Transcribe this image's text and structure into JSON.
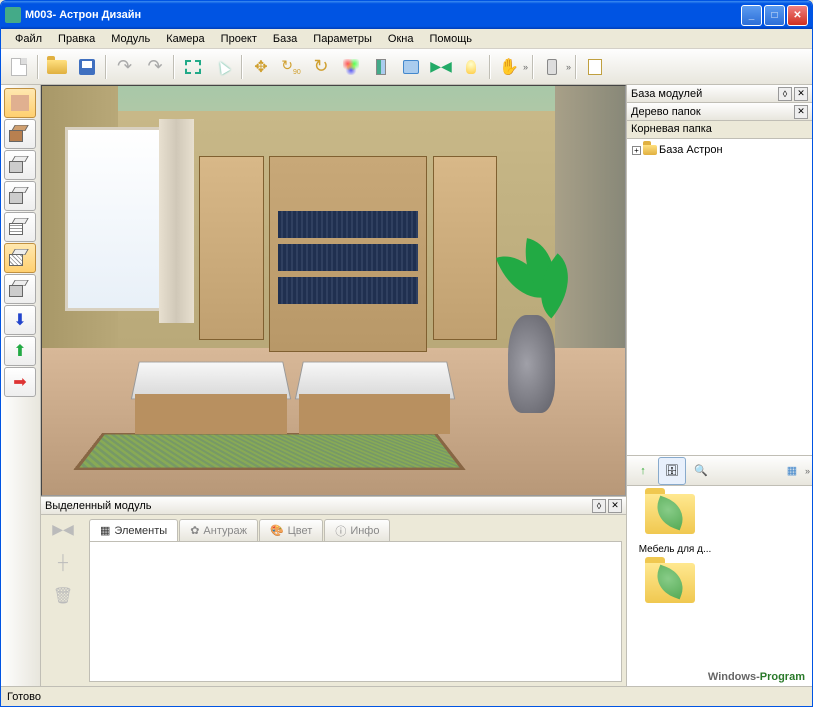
{
  "title": "М003- Астрон Дизайн",
  "menu": [
    "Файл",
    "Правка",
    "Модуль",
    "Камера",
    "Проект",
    "База",
    "Параметры",
    "Окна",
    "Помощь"
  ],
  "panels": {
    "selected_module": "Выделенный модуль",
    "module_base": "База модулей",
    "folder_tree": "Дерево папок",
    "root_folder": "Корневая папка",
    "tree_node": "База Астрон"
  },
  "tabs": [
    "Элементы",
    "Антураж",
    "Цвет",
    "Инфо"
  ],
  "thumb_label": "Мебель для д...",
  "status": "Готово",
  "watermark": {
    "p1": "Windows-",
    "p2": "Program"
  },
  "toolbar_icons": [
    "new",
    "open",
    "save",
    "undo",
    "redo",
    "select-rect",
    "select-cursor",
    "move",
    "rotate-90",
    "rotate",
    "materials",
    "door",
    "view",
    "mirror",
    "light",
    "pan",
    "phone",
    "report"
  ],
  "rot90_label": "90",
  "expand_chevron": "»",
  "left_tools": [
    "texture",
    "box-solid",
    "box-wire",
    "box-wire2",
    "box-hatch",
    "box-diag",
    "box-iso",
    "import",
    "export",
    "forward"
  ]
}
